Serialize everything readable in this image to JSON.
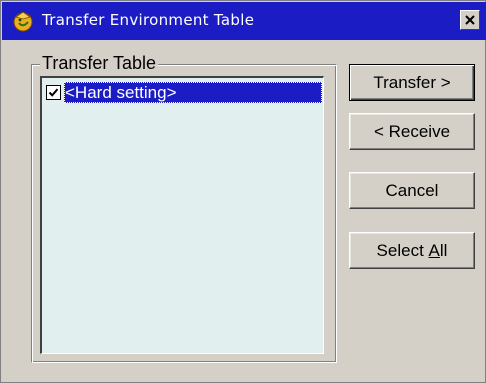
{
  "window": {
    "title": "Transfer Environment Table",
    "close_label": "✕"
  },
  "group": {
    "label": "Transfer Table"
  },
  "list": {
    "items": [
      {
        "label": "<Hard setting>",
        "checked": true,
        "selected": true
      }
    ]
  },
  "buttons": {
    "transfer": "Transfer >",
    "receive": "< Receive",
    "cancel": "Cancel",
    "select_all_prefix": "Select ",
    "select_all_mnemonic": "A",
    "select_all_suffix": "ll"
  },
  "colors": {
    "title_bar": "#1b1cc4",
    "window_face": "#d4d0c8",
    "list_background": "#e1f0ef",
    "selection": "#1b1cc4"
  },
  "icons": {
    "app": "app-icon",
    "close": "close-icon",
    "check": "checkmark-icon"
  }
}
